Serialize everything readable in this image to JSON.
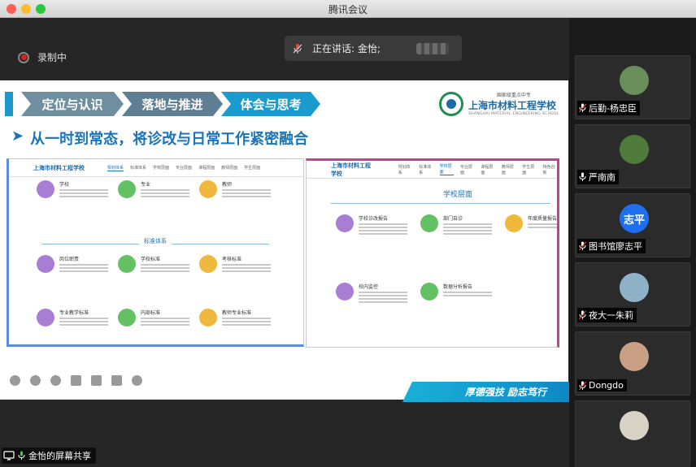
{
  "window": {
    "title": "腾讯会议"
  },
  "recording": {
    "label": "录制中"
  },
  "speaking": {
    "label": "正在讲话: 金怡;"
  },
  "slide": {
    "nav": [
      "定位与认识",
      "落地与推进",
      "体会与思考"
    ],
    "logo": {
      "tag": "国家级重点中专",
      "name": "上海市材料工程学校",
      "en": "SHANGHAI MATERIAL ENGINEERING SCHOOL"
    },
    "title": "从一时到常态，将诊改与日常工作紧密融合",
    "left_screenshot": {
      "logo": "上海市材料工程学校",
      "tabs": [
        "规划体系",
        "标准体系",
        "学校层面",
        "专业层面",
        "课程层面",
        "教师层面",
        "学生层面"
      ],
      "sections": [
        "标准体系"
      ],
      "cards": [
        "学校",
        "专业",
        "教师",
        "岗位职责",
        "学校标准",
        "考核标准",
        "专业教学标准",
        "内部标准",
        "教师专业标准"
      ]
    },
    "right_screenshot": {
      "logo": "上海市材料工程学校",
      "tabs": [
        "规划体系",
        "标准体系",
        "学校层面",
        "专业层面",
        "课程层面",
        "教师层面",
        "学生层面",
        "特色创新"
      ],
      "sections": [
        "学校层面"
      ],
      "cards": [
        "学校诊改报告",
        "部门自诊",
        "年度质量报告",
        "校内监控",
        "数据分析报告"
      ]
    },
    "banner": "厚德强技 励志笃行"
  },
  "share_label": "金怡的屏幕共享",
  "participants": [
    {
      "name": "后勤-杨忠臣",
      "avatar_color": "#6b8f5a",
      "muted": true
    },
    {
      "name": "严南南",
      "avatar_color": "#4f7a3a",
      "muted": false
    },
    {
      "name": "图书馆廖志平",
      "avatar_color": "#1e6ff0",
      "avatar_text": "志平",
      "muted": true
    },
    {
      "name": "夜大一朱莉",
      "avatar_color": "#8fb2c8",
      "muted": true
    },
    {
      "name": "Dongdo",
      "avatar_color": "#c9a084",
      "muted": true
    },
    {
      "name": "",
      "avatar_color": "#d8d2c6",
      "muted": false
    }
  ]
}
